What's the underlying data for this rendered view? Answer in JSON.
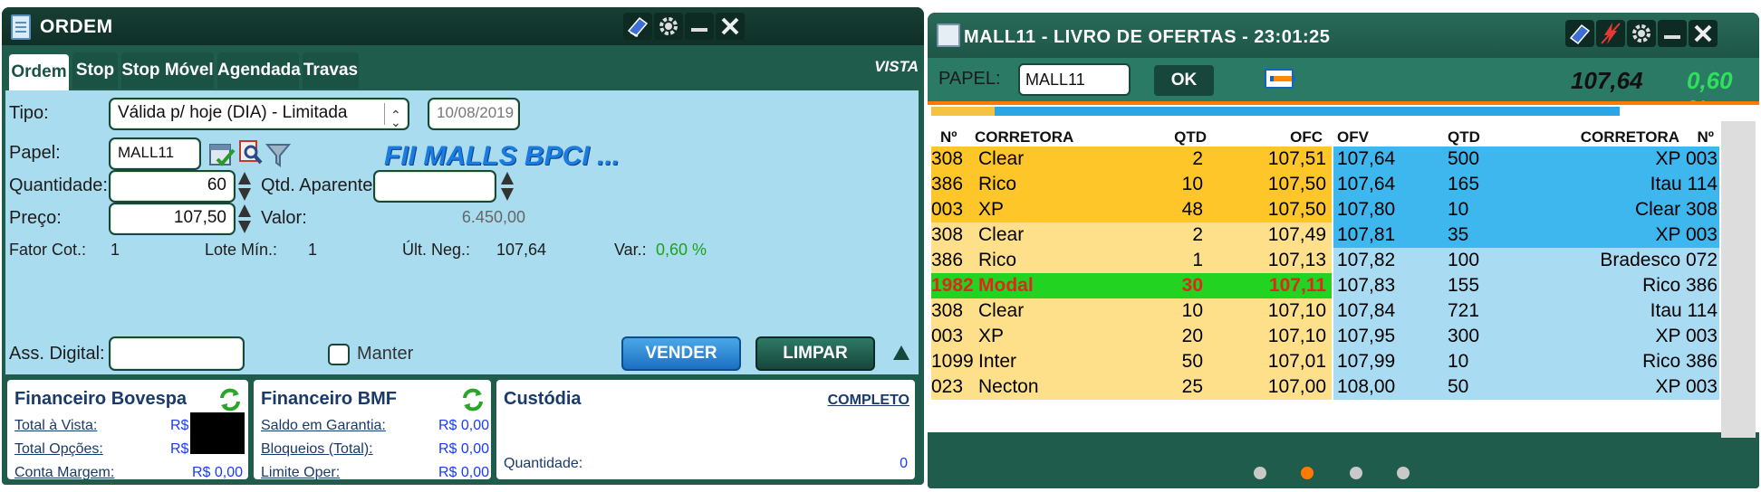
{
  "ordem": {
    "title": "ORDEM",
    "tabs": [
      "Ordem",
      "Stop",
      "Stop Móvel",
      "Agendada",
      "Travas"
    ],
    "vista": "VISTA",
    "tipo_label": "Tipo:",
    "tipo_value": "Válida p/ hoje (DIA) - Limitada",
    "date": "10/08/2019",
    "papel_label": "Papel:",
    "papel_value": "MALL11",
    "fii_name": "FII MALLS BPCI ...",
    "quantidade_label": "Quantidade:",
    "quantidade_value": "60",
    "qtd_aparente_label": "Qtd. Aparente:",
    "qtd_aparente_value": "",
    "preco_label": "Preço:",
    "preco_value": "107,50",
    "valor_label": "Valor:",
    "valor_value": "6.450,00",
    "fator_label": "Fator Cot.:",
    "fator_value": "1",
    "lote_label": "Lote Mín.:",
    "lote_value": "1",
    "ult_label": "Últ. Neg.:",
    "ult_value": "107,64",
    "var_label": "Var.:",
    "var_value": "0,60 %",
    "ass_label": "Ass. Digital:",
    "manter_label": "Manter",
    "vender_label": "VENDER",
    "limpar_label": "LIMPAR",
    "financeiro_bovespa": {
      "title": "Financeiro Bovespa",
      "rows": [
        {
          "label": "Total à Vista:",
          "value": "R$"
        },
        {
          "label": "Total Opções:",
          "value": "R$"
        },
        {
          "label": "Conta Margem:",
          "value": "R$ 0,00"
        }
      ]
    },
    "financeiro_bmf": {
      "title": "Financeiro BMF",
      "rows": [
        {
          "label": "Saldo em Garantia:",
          "value": "R$ 0,00"
        },
        {
          "label": "Bloqueios (Total):",
          "value": "R$ 0,00"
        },
        {
          "label": "Limite Oper:",
          "value": "R$ 0,00"
        }
      ]
    },
    "custodia": {
      "title": "Custódia",
      "link": "COMPLETO",
      "quantidade_label": "Quantidade:",
      "quantidade_value": "0"
    }
  },
  "livro": {
    "title": "MALL11 - LIVRO DE OFERTAS - 23:01:25",
    "papel_label": "PAPEL:",
    "papel_value": "MALL11",
    "ok_label": "OK",
    "price": "107,64",
    "pct": "0,60 %",
    "headers": {
      "n1": "Nº",
      "corretora1": "CORRETORA",
      "qtd1": "QTD",
      "ofc": "OFC",
      "ofv": "OFV",
      "qtd2": "QTD",
      "corretora2": "CORRETORA",
      "n2": "Nº"
    },
    "rows": [
      {
        "bn": "308",
        "bcorr": "Clear",
        "bqtd": "2",
        "ofc": "107,51",
        "ofv": "107,64",
        "sqtd": "500",
        "scorr": "XP 003"
      },
      {
        "bn": "386",
        "bcorr": "Rico",
        "bqtd": "10",
        "ofc": "107,50",
        "ofv": "107,64",
        "sqtd": "165",
        "scorr": "Itau 114"
      },
      {
        "bn": "003",
        "bcorr": "XP",
        "bqtd": "48",
        "ofc": "107,50",
        "ofv": "107,80",
        "sqtd": "10",
        "scorr": "Clear 308"
      },
      {
        "bn": "308",
        "bcorr": "Clear",
        "bqtd": "2",
        "ofc": "107,49",
        "ofv": "107,81",
        "sqtd": "35",
        "scorr": "XP 003"
      },
      {
        "bn": "386",
        "bcorr": "Rico",
        "bqtd": "1",
        "ofc": "107,13",
        "ofv": "107,82",
        "sqtd": "100",
        "scorr": "Bradesco 072"
      },
      {
        "bn": "1982",
        "bcorr": "Modal",
        "bqtd": "30",
        "ofc": "107,11",
        "ofv": "107,83",
        "sqtd": "155",
        "scorr": "Rico 386"
      },
      {
        "bn": "308",
        "bcorr": "Clear",
        "bqtd": "10",
        "ofc": "107,10",
        "ofv": "107,84",
        "sqtd": "721",
        "scorr": "Itau 114"
      },
      {
        "bn": "003",
        "bcorr": "XP",
        "bqtd": "20",
        "ofc": "107,10",
        "ofv": "107,95",
        "sqtd": "300",
        "scorr": "XP 003"
      },
      {
        "bn": "1099",
        "bcorr": "Inter",
        "bqtd": "50",
        "ofc": "107,01",
        "ofv": "107,99",
        "sqtd": "10",
        "scorr": "Rico 386"
      },
      {
        "bn": "023",
        "bcorr": "Necton",
        "bqtd": "25",
        "ofc": "107,00",
        "ofv": "108,00",
        "sqtd": "50",
        "scorr": "XP 003"
      }
    ],
    "highlight_row": 5,
    "colors": {
      "bid": "#ffc629",
      "bid_light": "#ffe08a",
      "ask": "#3db7ee",
      "ask_light": "#a9dcf3",
      "highlight": "#22d322",
      "highlight_text": "#e3261c"
    },
    "page_dots": 4,
    "active_dot": 1
  }
}
